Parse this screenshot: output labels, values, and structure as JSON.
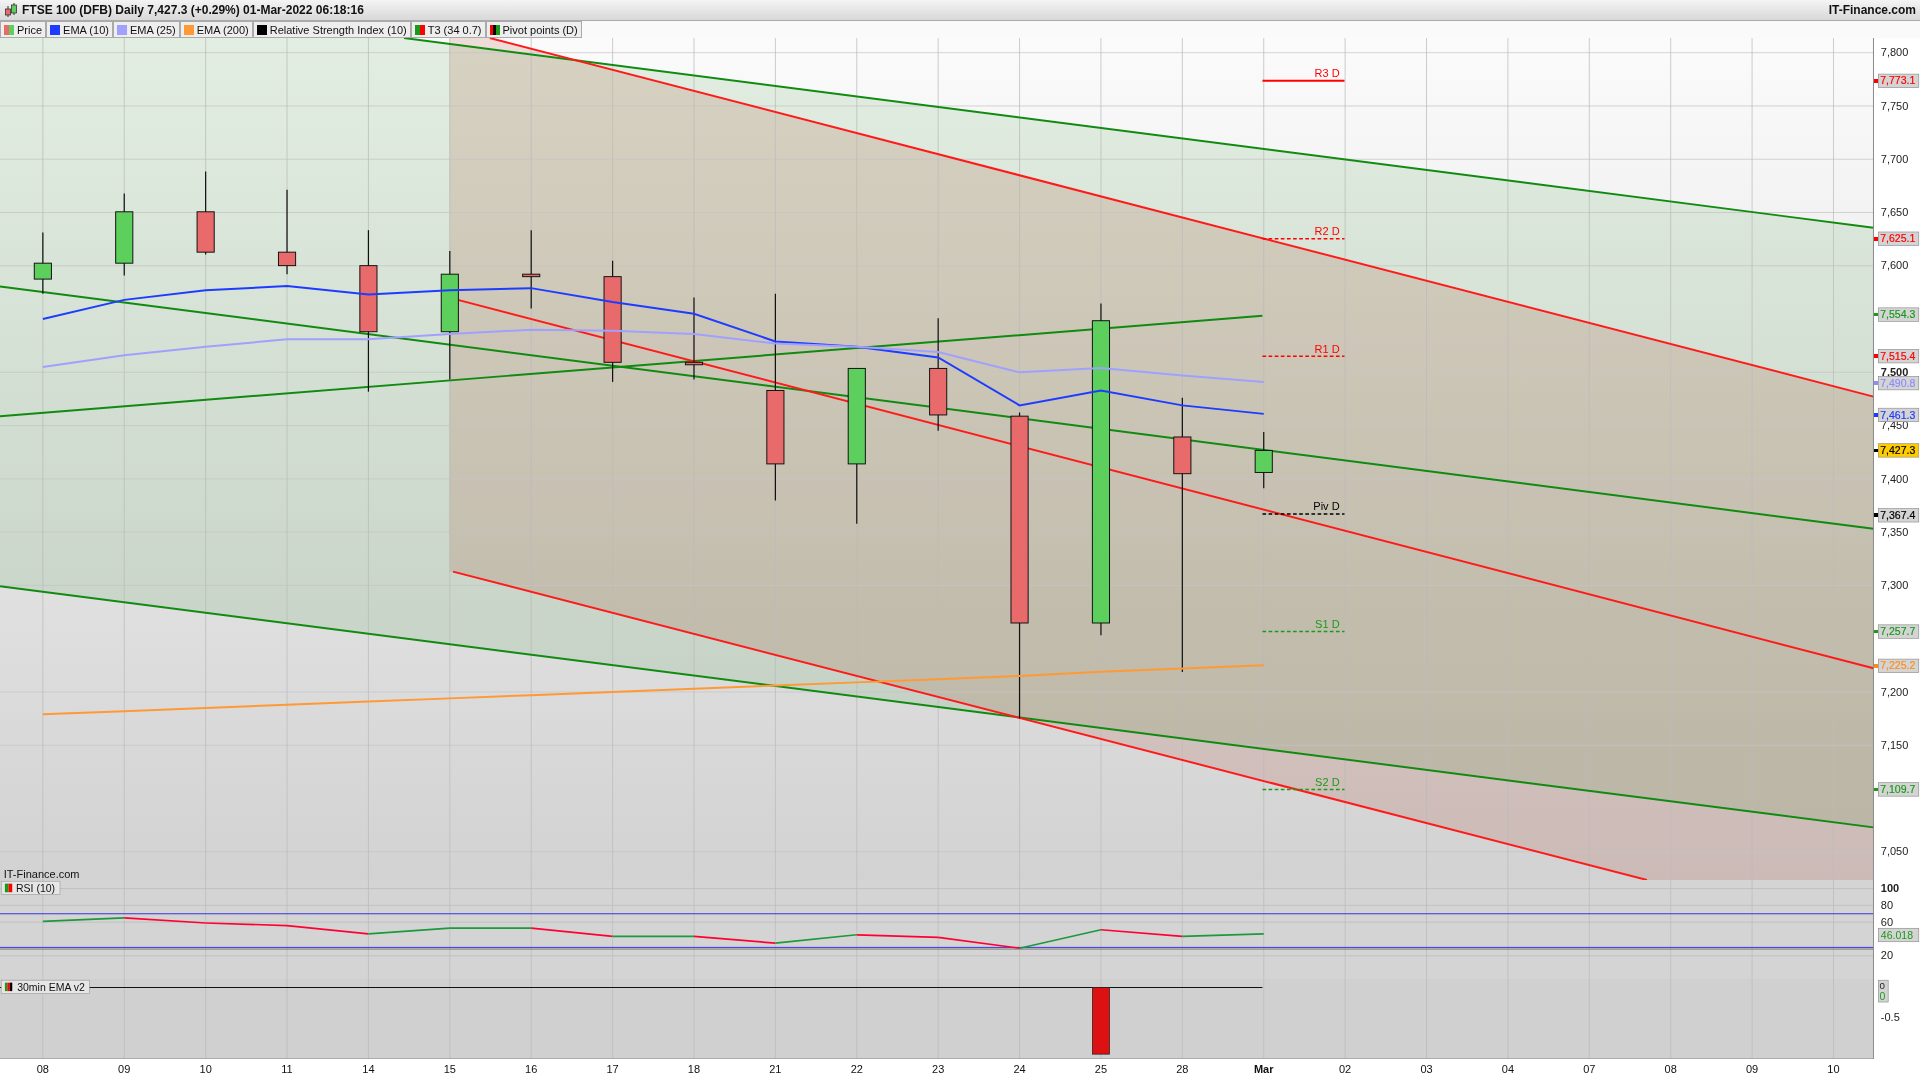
{
  "header": {
    "title": "FTSE 100 (DFB) Daily 7,427.3 (+0.29%) 01-Mar-2022 06:18:16",
    "brand": "IT-Finance.com"
  },
  "legend": [
    {
      "label": "Price",
      "kind": "candles"
    },
    {
      "label": "EMA (10)",
      "kind": "solid",
      "color": "#1e3cff"
    },
    {
      "label": "EMA (25)",
      "kind": "solid",
      "color": "#a0a0ff"
    },
    {
      "label": "EMA (200)",
      "kind": "solid",
      "color": "#ff9933"
    },
    {
      "label": "Relative Strength Index (10)",
      "kind": "solid",
      "color": "#000000"
    },
    {
      "label": "T3 (34 0.7)",
      "kind": "duo"
    },
    {
      "label": "Pivot points (D)",
      "kind": "trio"
    }
  ],
  "price_chart": {
    "provider": "IT-Finance.com",
    "ticks": [
      {
        "label": "7,800",
        "kind": "minor"
      },
      {
        "label": "7,750",
        "kind": "minor"
      },
      {
        "label": "7,700",
        "kind": "minor"
      },
      {
        "label": "7,650",
        "kind": "minor"
      },
      {
        "label": "7,600",
        "kind": "minor"
      },
      {
        "label": "7,500",
        "kind": "major"
      },
      {
        "label": "7,450",
        "kind": "minor"
      },
      {
        "label": "7,400",
        "kind": "minor"
      },
      {
        "label": "7,350",
        "kind": "minor"
      },
      {
        "label": "7,300",
        "kind": "minor"
      },
      {
        "label": "7,200",
        "kind": "minor"
      },
      {
        "label": "7,150",
        "kind": "minor"
      },
      {
        "label": "7,050",
        "kind": "minor"
      }
    ],
    "pivots": [
      {
        "label": "R3 D",
        "color": "#ff0000",
        "kind": "solid"
      },
      {
        "label": "R2 D",
        "color": "#ff0000",
        "kind": "dashed"
      },
      {
        "label": "R1 D",
        "color": "#ff0000",
        "kind": "dashed"
      },
      {
        "label": "Piv D",
        "color": "#000000",
        "kind": "dashed"
      },
      {
        "label": "S1 D",
        "color": "#1a9a1a",
        "kind": "dashed"
      },
      {
        "label": "S2 D",
        "color": "#1a9a1a",
        "kind": "dashed"
      }
    ],
    "price_tags": [
      {
        "label": "7,773.1",
        "color": "#ff0000",
        "kind": "level"
      },
      {
        "label": "7,625.1",
        "color": "#ff0000",
        "kind": "level"
      },
      {
        "label": "7,554.3",
        "color": "#1a9a1a",
        "kind": "level"
      },
      {
        "label": "7,515.4",
        "color": "#ff0000",
        "kind": "level"
      },
      {
        "label": "7,490.8",
        "color": "#8c8cff",
        "kind": "level"
      },
      {
        "label": "7,461.3",
        "color": "#1e3cff",
        "kind": "level"
      },
      {
        "label": "7,427.3",
        "kind": "last"
      },
      {
        "label": "7,367.4",
        "color": "#000000",
        "kind": "level"
      },
      {
        "label": "7,257.7",
        "color": "#1a9a1a",
        "kind": "level"
      },
      {
        "label": "7,225.2",
        "color": "#ff8c1a",
        "kind": "level"
      },
      {
        "label": "7,109.7",
        "color": "#1a9a1a",
        "kind": "level"
      }
    ]
  },
  "rsi_panel": {
    "label": "RSI (10)",
    "tag": "46.018",
    "ticks": [
      {
        "label": "100",
        "kind": "major"
      },
      {
        "label": "80",
        "kind": "minor"
      },
      {
        "label": "60",
        "kind": "minor"
      },
      {
        "label": "20",
        "kind": "minor"
      }
    ]
  },
  "ema_panel": {
    "label": "30min EMA v2",
    "ticks": [
      "0",
      "-0.5"
    ],
    "tag": "0"
  },
  "dates": [
    {
      "label": "08",
      "kind": "day"
    },
    {
      "label": "09",
      "kind": "day"
    },
    {
      "label": "10",
      "kind": "day"
    },
    {
      "label": "11",
      "kind": "day"
    },
    {
      "label": "14",
      "kind": "day"
    },
    {
      "label": "15",
      "kind": "day"
    },
    {
      "label": "16",
      "kind": "day"
    },
    {
      "label": "17",
      "kind": "day"
    },
    {
      "label": "18",
      "kind": "day"
    },
    {
      "label": "21",
      "kind": "day"
    },
    {
      "label": "22",
      "kind": "day"
    },
    {
      "label": "23",
      "kind": "day"
    },
    {
      "label": "24",
      "kind": "day"
    },
    {
      "label": "25",
      "kind": "day"
    },
    {
      "label": "28",
      "kind": "day"
    },
    {
      "label": "Mar",
      "kind": "month"
    },
    {
      "label": "02",
      "kind": "day"
    },
    {
      "label": "03",
      "kind": "day"
    },
    {
      "label": "04",
      "kind": "day"
    },
    {
      "label": "07",
      "kind": "day"
    },
    {
      "label": "08",
      "kind": "day"
    },
    {
      "label": "09",
      "kind": "day"
    },
    {
      "label": "10",
      "kind": "day"
    }
  ]
}
